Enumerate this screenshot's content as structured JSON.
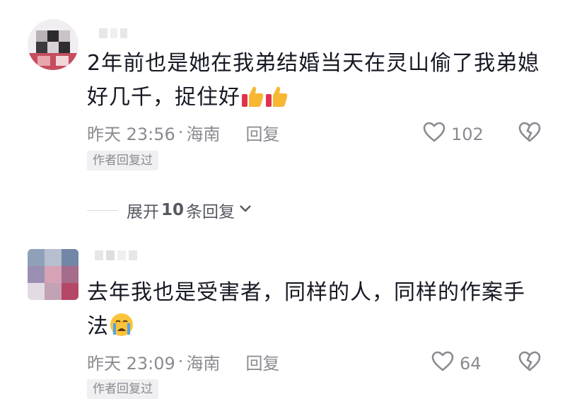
{
  "comments": [
    {
      "text_line1": "2年前也是她在我弟结婚当天在灵山偷了我弟媳",
      "text_line2": "好几千，捉住好",
      "emojis": [
        "thumbs-up-icon",
        "thumbs-up-icon"
      ],
      "time": "昨天 23:56",
      "separator": "·",
      "location": "海南",
      "reply_label": "回复",
      "likes": "102",
      "badge": "作者回复过"
    },
    {
      "text_line1": "去年我也是受害者，同样的人，同样的作案手",
      "text_line2": "法",
      "emojis": [
        "crying-face-icon"
      ],
      "time": "昨天 23:09",
      "separator": "·",
      "location": "海南",
      "reply_label": "回复",
      "likes": "64",
      "badge": "作者回复过"
    }
  ],
  "expand_replies": {
    "label": "展开",
    "count": "10",
    "suffix": "条回复"
  },
  "colors": {
    "text": "#161823",
    "meta": "#8a8b91",
    "badge_bg": "#f0f0f2"
  }
}
